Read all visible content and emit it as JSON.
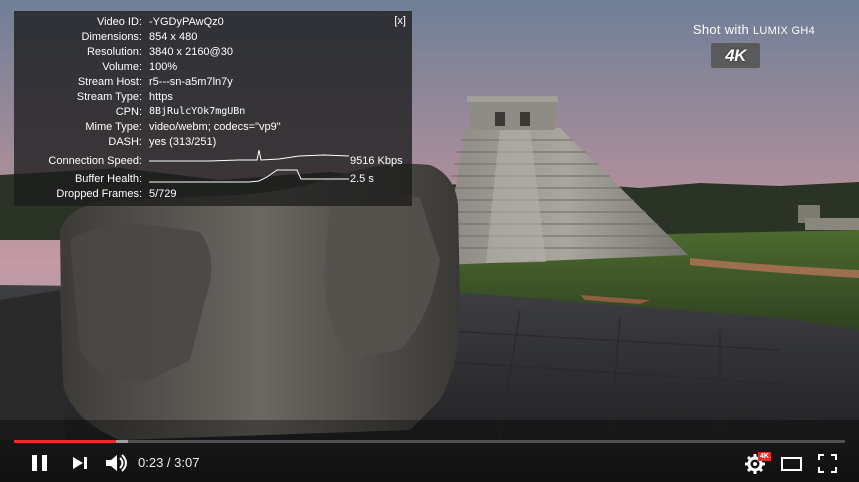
{
  "stats": {
    "close_label": "[x]",
    "rows": [
      {
        "label": "Video ID:",
        "value": "-YGDyPAwQz0"
      },
      {
        "label": "Dimensions:",
        "value": "854 x 480"
      },
      {
        "label": "Resolution:",
        "value": "3840 x 2160@30"
      },
      {
        "label": "Volume:",
        "value": "100%"
      },
      {
        "label": "Stream Host:",
        "value": "r5---sn-a5m7ln7y"
      },
      {
        "label": "Stream Type:",
        "value": "https"
      },
      {
        "label": "CPN:",
        "value": "8BjRulcYOk7mgUBn"
      },
      {
        "label": "Mime Type:",
        "value": "video/webm; codecs=\"vp9\""
      },
      {
        "label": "DASH:",
        "value": "yes (313/251)"
      }
    ],
    "connection_speed": {
      "label": "Connection Speed:",
      "value": "9516 Kbps"
    },
    "buffer_health": {
      "label": "Buffer Health:",
      "value": "2.5 s"
    },
    "dropped_frames": {
      "label": "Dropped Frames:",
      "value": "5/729"
    }
  },
  "branding": {
    "shot_with": "Shot with",
    "camera": "LUMIX GH4",
    "badge": "4K"
  },
  "controls": {
    "current_time": "0:23",
    "separator": " / ",
    "duration": "3:07",
    "time_display": "0:23 / 3:07",
    "played_fraction": 0.123,
    "buffered_fraction": 0.137,
    "quality_badge": "4K"
  },
  "colors": {
    "accent": "#e52d27",
    "overlay_bg": "#1c1c1c"
  }
}
